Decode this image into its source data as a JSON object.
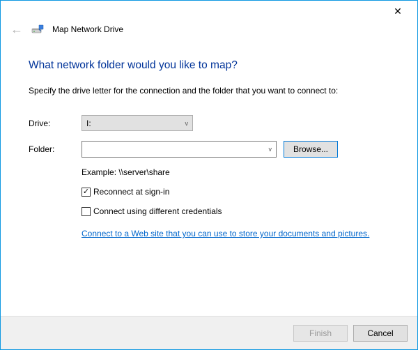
{
  "window": {
    "title": "Map Network Drive",
    "close_glyph": "✕"
  },
  "heading": "What network folder would you like to map?",
  "instruction": "Specify the drive letter for the connection and the folder that you want to connect to:",
  "form": {
    "drive_label": "Drive:",
    "drive_value": "I:",
    "folder_label": "Folder:",
    "folder_value": "",
    "browse_label": "Browse...",
    "example": "Example: \\\\server\\share"
  },
  "options": {
    "reconnect_label": "Reconnect at sign-in",
    "reconnect_checked": "✓",
    "diff_creds_label": "Connect using different credentials",
    "link_text": "Connect to a Web site that you can use to store your documents and pictures."
  },
  "buttons": {
    "finish": "Finish",
    "cancel": "Cancel"
  }
}
